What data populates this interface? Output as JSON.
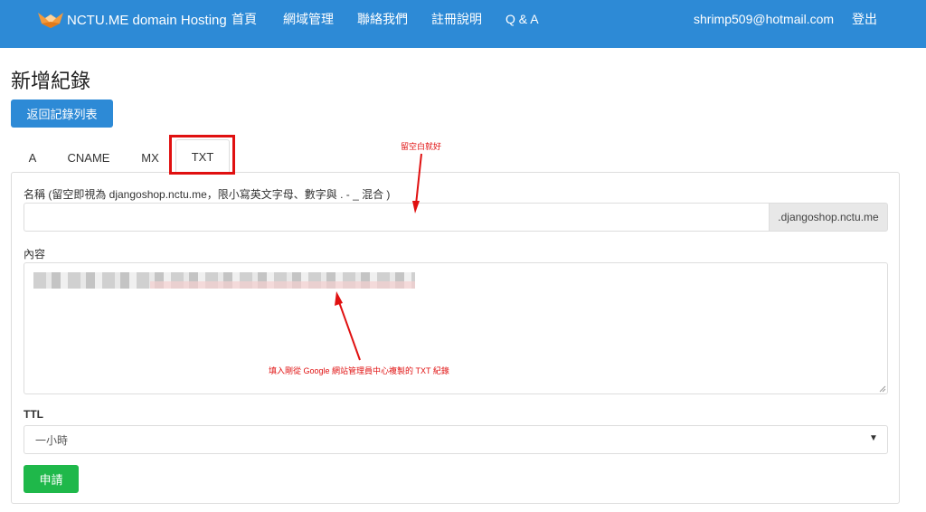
{
  "navbar": {
    "brand": "NCTU.ME domain Hosting",
    "links": [
      "首頁",
      "網域管理",
      "聯絡我們",
      "註冊說明",
      "Q & A"
    ],
    "user_email": "shrimp509@hotmail.com",
    "logout": "登出",
    "background": "#2d8ad6"
  },
  "page": {
    "title": "新增紀錄",
    "back_button": "返回記錄列表"
  },
  "tabs": [
    {
      "label": "A",
      "active": false
    },
    {
      "label": "CNAME",
      "active": false
    },
    {
      "label": "MX",
      "active": false
    },
    {
      "label": "TXT",
      "active": true
    }
  ],
  "form": {
    "name_label": "名稱 (留空即視為 djangoshop.nctu.me，限小寫英文字母、數字與 . - _ 混合 )",
    "name_value": "",
    "name_suffix": ".djangoshop.nctu.me",
    "content_label": "內容",
    "ttl_label": "TTL",
    "ttl_selected": "一小時",
    "submit": "申請"
  },
  "annotations": {
    "leave_blank": "留空白就好",
    "paste_txt": "填入剛從 Google 網站管理員中心複製的 TXT 紀錄",
    "color": "#e01010"
  }
}
